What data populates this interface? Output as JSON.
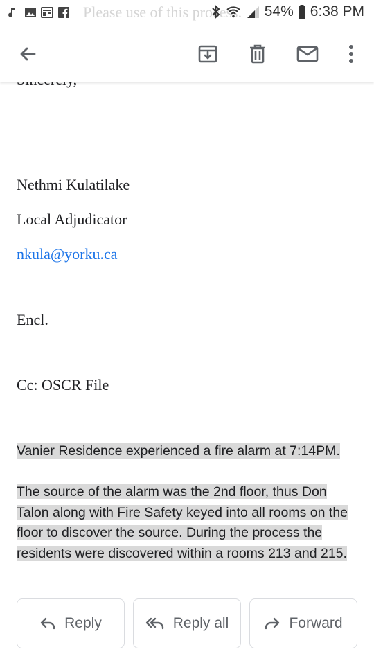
{
  "status_bar": {
    "faded_text": "Please use of this process.",
    "battery": "54%",
    "time": "6:38 PM"
  },
  "toolbar": {
    "back": "back",
    "archive": "archive",
    "delete": "delete",
    "mark_unread": "mark unread",
    "more": "more options"
  },
  "email": {
    "closing": "Sincerely,",
    "sender_name": "Nethmi Kulatilake",
    "sender_title": "Local Adjudicator",
    "sender_email": "nkula@yorku.ca",
    "encl": "Encl.",
    "cc": "Cc:  OSCR File",
    "para1": "Vanier Residence experienced a fire alarm at 7:14PM.",
    "para2_lines": [
      "The source of the alarm was the 2nd floor, thus Don",
      "Talon along with Fire Safety keyed into all rooms on the",
      "floor to discover the source. During the process the",
      "residents were discovered within a rooms 213 and 215."
    ]
  },
  "actions": {
    "reply": "Reply",
    "reply_all": "Reply all",
    "forward": "Forward"
  }
}
